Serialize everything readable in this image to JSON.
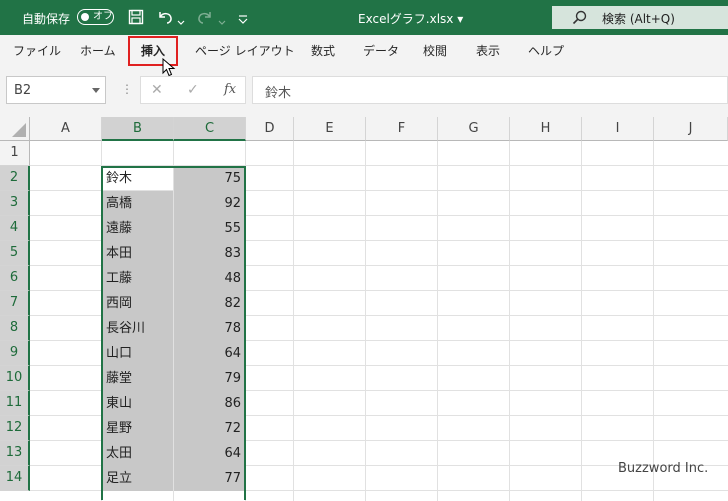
{
  "titlebar": {
    "autosave_label": "自動保存",
    "autosave_state": "オフ",
    "document_title": "Excelグラフ.xlsx",
    "search_placeholder": "検索 (Alt+Q)"
  },
  "ribbon": {
    "tabs": [
      "ファイル",
      "ホーム",
      "挿入",
      "ページ レイアウト",
      "数式",
      "データ",
      "校閲",
      "表示",
      "ヘルプ"
    ],
    "highlighted_tab": "挿入"
  },
  "formula_bar": {
    "name_box": "B2",
    "formula": "鈴木",
    "fx_label": "fx"
  },
  "sheet": {
    "columns": [
      "A",
      "B",
      "C",
      "D",
      "E",
      "F",
      "G",
      "H",
      "I",
      "J"
    ],
    "rows": [
      "1",
      "2",
      "3",
      "4",
      "5",
      "6",
      "7",
      "8",
      "9",
      "10",
      "11",
      "12",
      "13",
      "14"
    ],
    "selected_columns": [
      "B",
      "C"
    ],
    "active_cell": "B2",
    "data": [
      {
        "name": "鈴木",
        "value": "75"
      },
      {
        "name": "高橋",
        "value": "92"
      },
      {
        "name": "遠藤",
        "value": "55"
      },
      {
        "name": "本田",
        "value": "83"
      },
      {
        "name": "工藤",
        "value": "48"
      },
      {
        "name": "西岡",
        "value": "82"
      },
      {
        "name": "長谷川",
        "value": "78"
      },
      {
        "name": "山口",
        "value": "64"
      },
      {
        "name": "藤堂",
        "value": "79"
      },
      {
        "name": "東山",
        "value": "86"
      },
      {
        "name": "星野",
        "value": "72"
      },
      {
        "name": "太田",
        "value": "64"
      },
      {
        "name": "足立",
        "value": "77"
      }
    ]
  },
  "watermark": "Buzzword Inc.",
  "colors": {
    "accent": "#217346",
    "highlight_box": "#e02020",
    "selection": "#c8c8c8"
  }
}
